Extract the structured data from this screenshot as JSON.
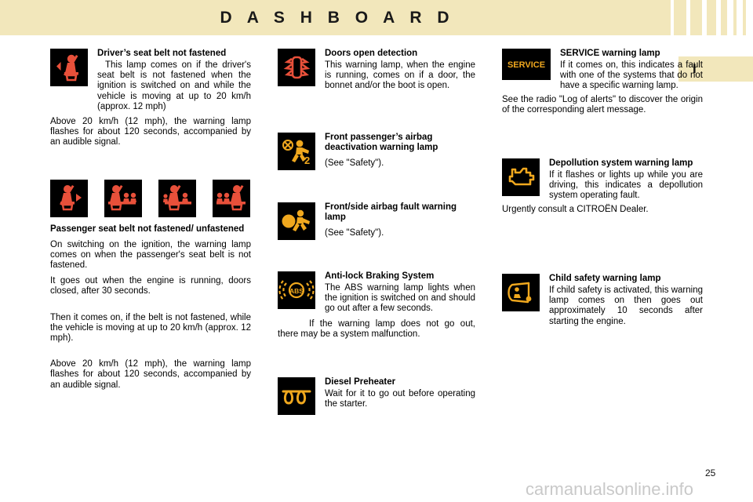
{
  "header": {
    "title": "D A S H B O A R D",
    "chapter_tab": "I",
    "accent_color": "#f2e7bb"
  },
  "footer": {
    "page_number": "25",
    "watermark": "carmanualsonline.info"
  },
  "column1": {
    "driver_belt": {
      "icon": "driver-seat-belt-not-fastened-icon",
      "heading": "Driver’s seat belt not fastened",
      "para1": "This lamp comes on if the driver's seat belt is not fastened when the ignition is switched on and while the vehicle is moving at up to 20 km/h (approx. 12 mph)",
      "para2": "Above 20 km/h (12 mph), the warning lamp flashes for about 120 seconds, accompanied by an audible signal."
    },
    "passenger_belt": {
      "icons": [
        "passenger-belt-icon-1",
        "passenger-belt-icon-2",
        "passenger-belt-icon-3",
        "passenger-belt-icon-4"
      ],
      "heading": "Passenger seat belt not fastened/ unfastened",
      "para1": "On switching on the ignition, the warning lamp comes on when the passenger's seat belt is not fastened.",
      "para2": "It goes out when the engine is running, doors closed, after 30 seconds.",
      "para3": "Then it comes on, if the belt is not fastened, while the vehicle is moving at up to 20 km/h (approx. 12 mph).",
      "para4": "Above 20 km/h (12 mph), the warning lamp flashes for about 120 seconds, accompanied by an audible signal."
    }
  },
  "column2": {
    "doors_open": {
      "icon": "doors-open-detection-icon",
      "heading": "Doors open detection",
      "para1": "This warning lamp, when the engine is running, comes on if a door, the bonnet and/or the boot is open."
    },
    "passenger_airbag_deactivation": {
      "icon": "front-passenger-airbag-deactivation-icon",
      "heading": "Front passenger’s airbag deactivation warning lamp",
      "para1": "(See \"Safety\")."
    },
    "airbag_fault": {
      "icon": "front-side-airbag-fault-icon",
      "heading": "Front/side airbag fault warning lamp",
      "para1": "(See \"Safety\")."
    },
    "abs": {
      "icon": "anti-lock-braking-system-icon",
      "icon_label": "ABS",
      "heading": "Anti-lock Braking System",
      "para1": "The ABS warning lamp lights when the ignition is switched on and should go out after a few seconds.",
      "para2": "If the warning lamp does not go out, there may be a system malfunction."
    },
    "diesel_preheater": {
      "icon": "diesel-preheater-icon",
      "heading": "Diesel Preheater",
      "para1": "Wait for it to go out before operating the starter."
    }
  },
  "column3": {
    "service": {
      "icon": "service-warning-lamp-icon",
      "icon_label": "SERVICE",
      "heading": "SERVICE warning lamp",
      "para1": "If it comes on, this indicates a fault with one of the systems that do not have a specific warning lamp.",
      "para2": "See the radio \"Log of alerts\" to discover the origin of the corresponding alert message."
    },
    "depollution": {
      "icon": "depollution-system-warning-icon",
      "heading": "Depollution system warning lamp",
      "para1": "If it flashes or lights up while you are driving, this indicates a depollution system operating fault.",
      "para2": "Urgently consult a CITROËN Dealer."
    },
    "child_safety": {
      "icon": "child-safety-warning-lamp-icon",
      "heading": "Child safety warning lamp",
      "para1": "If child safety is activated, this warning lamp comes on then goes out approximately 10 seconds after starting the engine."
    }
  },
  "colors": {
    "icon_background": "#000000",
    "red_symbol": "#e8503a",
    "amber_symbol": "#f0a81e",
    "header_band": "#f2e7bb"
  }
}
